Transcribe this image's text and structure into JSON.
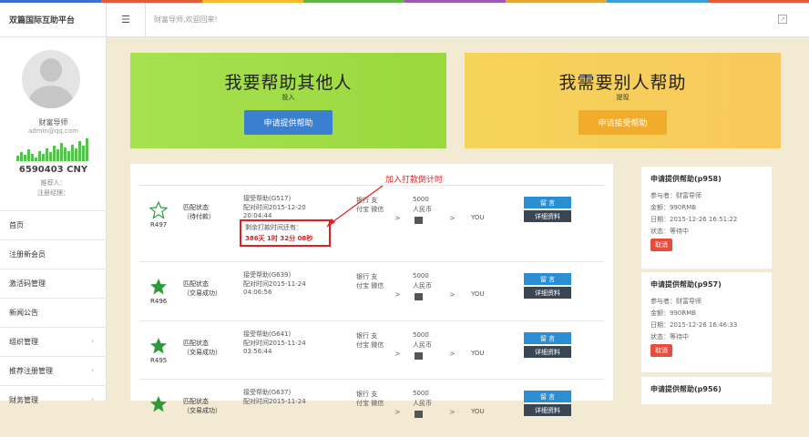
{
  "brand": "双篇国际互助平台",
  "topbar": {
    "welcome": "财富导师,欢迎回来!"
  },
  "colors": {
    "stripe": [
      "#3b6fd4",
      "#e05a3b",
      "#f5b92e",
      "#62b34a",
      "#9b59b6",
      "#e0a83b",
      "#3b9ed4",
      "#e05a3b"
    ],
    "green": "#a6e14f",
    "orange": "#f0ac2a",
    "red": "#e02020"
  },
  "user": {
    "name": "财富导师",
    "email": "admin@qq.com",
    "balance": "6590403 CNY",
    "referrer": "推荐人：",
    "manager": "注册经理："
  },
  "nav": [
    {
      "label": "首页",
      "icon": ""
    },
    {
      "label": "注册新会员",
      "icon": ""
    },
    {
      "label": "激活码管理",
      "icon": ""
    },
    {
      "label": "新闻公告",
      "icon": ""
    },
    {
      "label": "组织管理",
      "icon": "chevron-left"
    },
    {
      "label": "推荐注册管理",
      "icon": "chevron-left"
    },
    {
      "label": "财务管理",
      "icon": "chevron-left"
    }
  ],
  "panels": {
    "left": {
      "title": "我要帮助其他人",
      "sub": "投入",
      "button": "申请提供帮助"
    },
    "right": {
      "title": "我需要别人帮助",
      "sub": "提现",
      "button": "申请接受帮助"
    }
  },
  "annotation": "加入打款倒计时",
  "countdown": {
    "label": "剩余打款时间还有：",
    "value": "386天 1时 32分 08秒"
  },
  "rows": [
    {
      "id": "R497",
      "filled": false,
      "status1": "匹配状态",
      "status2": "（待付款）",
      "line1": "接受帮助(G517)",
      "line2": "配对时间2015-12-20",
      "line3": "20:04:44",
      "pay1": "银行 支",
      "pay2": "付宝 微信",
      "amt1": "5000",
      "amt2": "人民币",
      "arrow": ">",
      "you": "YOU",
      "btn1": "留 言",
      "btn2": "详细资料"
    },
    {
      "id": "R496",
      "filled": true,
      "status1": "匹配状态",
      "status2": "（交易成功）",
      "line1": "接受帮助(G639)",
      "line2": "配对时间2015-11-24",
      "line3": "04:06:56",
      "pay1": "银行 支",
      "pay2": "付宝 微信",
      "amt1": "5000",
      "amt2": "人民币",
      "arrow": ">",
      "you": "YOU",
      "btn1": "留 言",
      "btn2": "详细资料"
    },
    {
      "id": "R495",
      "filled": true,
      "status1": "匹配状态",
      "status2": "（交易成功）",
      "line1": "接受帮助(G641)",
      "line2": "配对时间2015-11-24",
      "line3": "03:56:44",
      "pay1": "银行 支",
      "pay2": "付宝 微信",
      "amt1": "5000",
      "amt2": "人民币",
      "arrow": ">",
      "you": "YOU",
      "btn1": "留 言",
      "btn2": "详细资料"
    },
    {
      "id": "",
      "filled": true,
      "status1": "匹配状态",
      "status2": "（交易成功）",
      "line1": "接受帮助(G637)",
      "line2": "配对时间2015-11-24",
      "line3": "",
      "pay1": "银行 支",
      "pay2": "付宝 微信",
      "amt1": "5000",
      "amt2": "人民币",
      "arrow": ">",
      "you": "YOU",
      "btn1": "留 言",
      "btn2": "详细资料"
    }
  ],
  "side_cards": [
    {
      "title": "申请提供帮助(p958)",
      "person": "参与者：财富导师",
      "amount": "金额：990RMB",
      "date": "日期：2015-12-26 16:51:22",
      "status": "状态：等待中",
      "cancel": "取消"
    },
    {
      "title": "申请提供帮助(p957)",
      "person": "参与者：财富导师",
      "amount": "金额：990RMB",
      "date": "日期：2015-12-26 16:46:33",
      "status": "状态：等待中",
      "cancel": "取消"
    },
    {
      "title": "申请提供帮助(p956)"
    }
  ],
  "chart_bars": [
    4,
    7,
    5,
    9,
    6,
    3,
    8,
    6,
    10,
    7,
    12,
    9,
    14,
    11,
    8,
    13,
    10,
    16,
    12,
    18
  ]
}
